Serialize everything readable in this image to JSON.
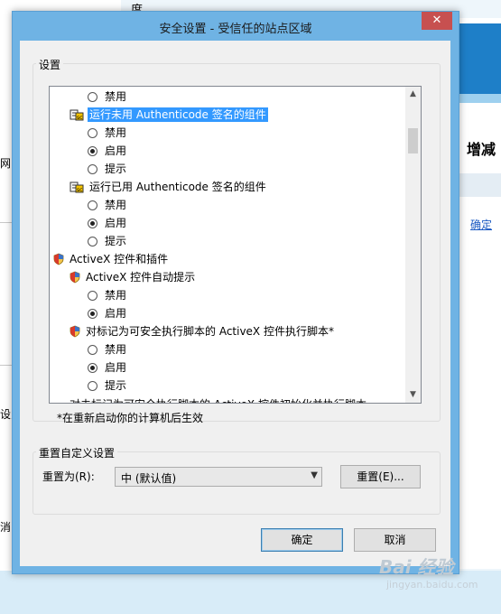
{
  "background": {
    "top_text": "度",
    "right_title": "增减",
    "right_link": "确定",
    "left_fragments": [
      "网",
      "设为",
      "消"
    ]
  },
  "watermark": {
    "brand": "Bai 经验",
    "url": "jingyan.baidu.com"
  },
  "dialog": {
    "title": "安全设置 - 受信任的站点区域",
    "close_glyph": "✕",
    "settings_group_label": "设置",
    "settings_items": [
      {
        "kind": "radio",
        "label": "禁用",
        "checked": false,
        "indent": 1
      },
      {
        "kind": "header-script",
        "label": "运行未用 Authenticode 签名的组件",
        "selected": true,
        "indent": 0
      },
      {
        "kind": "radio",
        "label": "禁用",
        "checked": false,
        "indent": 1
      },
      {
        "kind": "radio",
        "label": "启用",
        "checked": true,
        "indent": 1
      },
      {
        "kind": "radio",
        "label": "提示",
        "checked": false,
        "indent": 1
      },
      {
        "kind": "header-script",
        "label": "运行已用 Authenticode 签名的组件",
        "selected": false,
        "indent": 0
      },
      {
        "kind": "radio",
        "label": "禁用",
        "checked": false,
        "indent": 1
      },
      {
        "kind": "radio",
        "label": "启用",
        "checked": true,
        "indent": 1
      },
      {
        "kind": "radio",
        "label": "提示",
        "checked": false,
        "indent": 1
      },
      {
        "kind": "header-shield",
        "label": "ActiveX 控件和插件",
        "selected": false,
        "indent": -1
      },
      {
        "kind": "header-shield",
        "label": "ActiveX 控件自动提示",
        "selected": false,
        "indent": 0
      },
      {
        "kind": "radio",
        "label": "禁用",
        "checked": false,
        "indent": 1
      },
      {
        "kind": "radio",
        "label": "启用",
        "checked": true,
        "indent": 1
      },
      {
        "kind": "header-shield",
        "label": "对标记为可安全执行脚本的 ActiveX 控件执行脚本*",
        "selected": false,
        "indent": 0
      },
      {
        "kind": "radio",
        "label": "禁用",
        "checked": false,
        "indent": 1
      },
      {
        "kind": "radio",
        "label": "启用",
        "checked": true,
        "indent": 1
      },
      {
        "kind": "radio",
        "label": "提示",
        "checked": false,
        "indent": 1
      }
    ],
    "cutoff_item": "对未标记为可安全执行脚本的 ActiveX 控件初始化并执行脚本",
    "restart_note": "*在重新启动你的计算机后生效",
    "reset_group_label": "重置自定义设置",
    "reset_to_label": "重置为(R):",
    "reset_combo_value": "中 (默认值)",
    "reset_button": "重置(E)...",
    "ok_button": "确定",
    "cancel_button": "取消"
  }
}
